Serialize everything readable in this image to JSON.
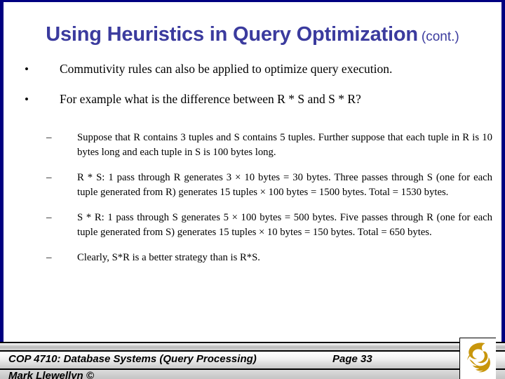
{
  "slide": {
    "title_main": "Using Heuristics in Query Optimization",
    "title_suffix": "(cont.)",
    "title_color": "#3b3b9e",
    "border_color": "#000080",
    "bullets": [
      {
        "marker": "•",
        "text": "Commutivity rules can also be applied to optimize query execution."
      },
      {
        "marker": "•",
        "text": "For example what is the difference between R * S and S * R?"
      }
    ],
    "sub_bullets": [
      {
        "marker": "–",
        "text": "Suppose that R contains 3 tuples and S contains 5 tuples.  Further suppose that each tuple in R is 10 bytes long and each tuple in S is 100 bytes long."
      },
      {
        "marker": "–",
        "text": "R * S: 1 pass through R generates 3 × 10 bytes = 30 bytes.  Three passes through S (one for each tuple generated from R) generates 15 tuples × 100 bytes = 1500 bytes.  Total = 1530 bytes."
      },
      {
        "marker": "–",
        "text": "S * R: 1 pass through S generates 5 × 100 bytes = 500 bytes.  Five passes through R (one for each tuple generated from S) generates 15 tuples × 10 bytes = 150 bytes.  Total = 650 bytes."
      },
      {
        "marker": "–",
        "text": "Clearly, S*R is a better strategy than is R*S."
      }
    ]
  },
  "footer": {
    "course": "COP 4710: Database Systems (Query Processing)",
    "page": "Page 33",
    "author": "Mark Llewellyn ©",
    "logo_name": "ucf-pegasus-logo",
    "logo_color": "#c8960c"
  }
}
